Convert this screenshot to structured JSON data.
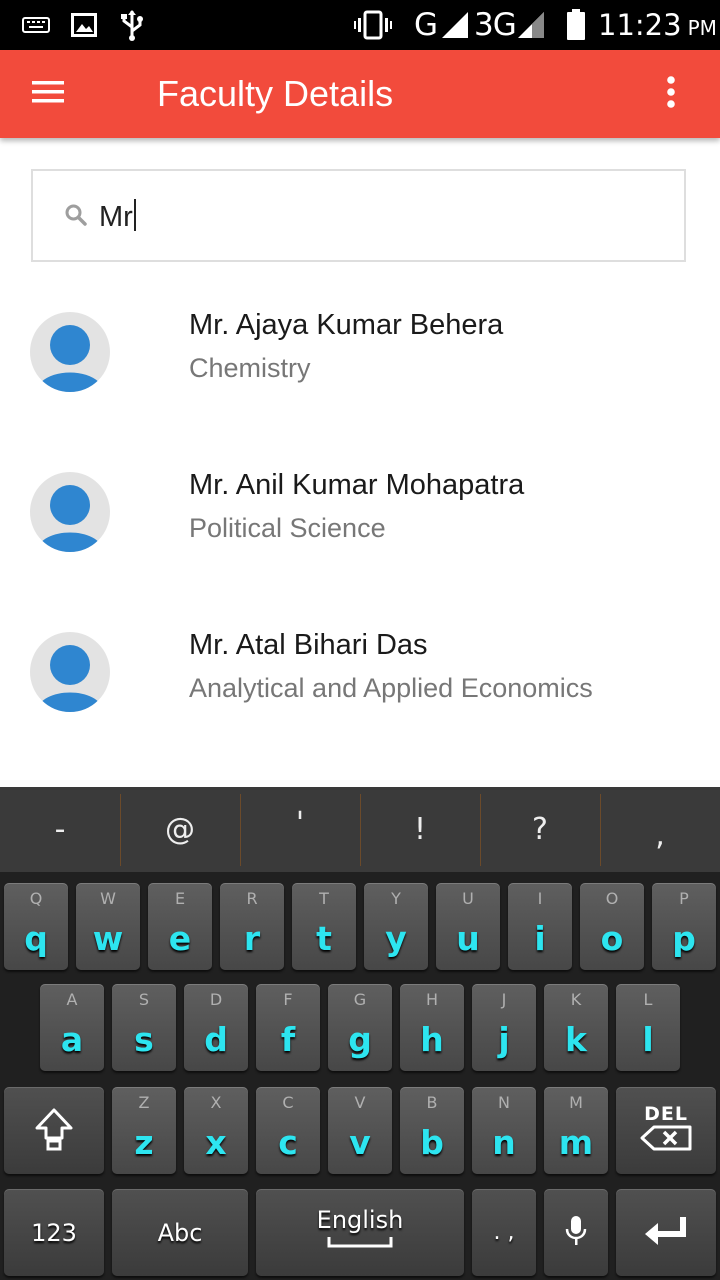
{
  "status_bar": {
    "time": "11:23",
    "ampm": "PM",
    "network_1": "G",
    "network_2": "3G",
    "icons": [
      "keyboard-icon",
      "image-icon",
      "usb-icon",
      "vibrate-icon",
      "signal-icon",
      "signal-icon",
      "battery-icon"
    ]
  },
  "app_bar": {
    "title": "Faculty Details",
    "menu_icon": "hamburger-menu-icon",
    "more_icon": "more-vertical-icon",
    "color": "#f24b3c"
  },
  "search": {
    "value": "Mr",
    "icon": "search-icon"
  },
  "faculty": [
    {
      "name": "Mr. Ajaya Kumar Behera",
      "department": "Chemistry"
    },
    {
      "name": "Mr. Anil Kumar Mohapatra",
      "department": "Political Science"
    },
    {
      "name": "Mr. Atal Bihari Das",
      "department": "Analytical and Applied Economics"
    }
  ],
  "keyboard": {
    "suggestions": [
      "-",
      "@",
      "'",
      "!",
      "?",
      ","
    ],
    "row1": [
      {
        "ch": "q",
        "hint": "Q"
      },
      {
        "ch": "w",
        "hint": "W"
      },
      {
        "ch": "e",
        "hint": "E"
      },
      {
        "ch": "r",
        "hint": "R"
      },
      {
        "ch": "t",
        "hint": "T"
      },
      {
        "ch": "y",
        "hint": "Y"
      },
      {
        "ch": "u",
        "hint": "U"
      },
      {
        "ch": "i",
        "hint": "I"
      },
      {
        "ch": "o",
        "hint": "O"
      },
      {
        "ch": "p",
        "hint": "P"
      }
    ],
    "row2": [
      {
        "ch": "a",
        "hint": "A"
      },
      {
        "ch": "s",
        "hint": "S"
      },
      {
        "ch": "d",
        "hint": "D"
      },
      {
        "ch": "f",
        "hint": "F"
      },
      {
        "ch": "g",
        "hint": "G"
      },
      {
        "ch": "h",
        "hint": "H"
      },
      {
        "ch": "j",
        "hint": "J"
      },
      {
        "ch": "k",
        "hint": "K"
      },
      {
        "ch": "l",
        "hint": "L"
      }
    ],
    "row3": [
      {
        "ch": "z",
        "hint": "Z"
      },
      {
        "ch": "x",
        "hint": "X"
      },
      {
        "ch": "c",
        "hint": "C"
      },
      {
        "ch": "v",
        "hint": "V"
      },
      {
        "ch": "b",
        "hint": "B"
      },
      {
        "ch": "n",
        "hint": "N"
      },
      {
        "ch": "m",
        "hint": "M"
      }
    ],
    "del_label": "DEL",
    "num_label": "123",
    "abc_label": "Abc",
    "lang_label": "English",
    "punct_label": ". ,",
    "key_color": "#2de5f0"
  }
}
